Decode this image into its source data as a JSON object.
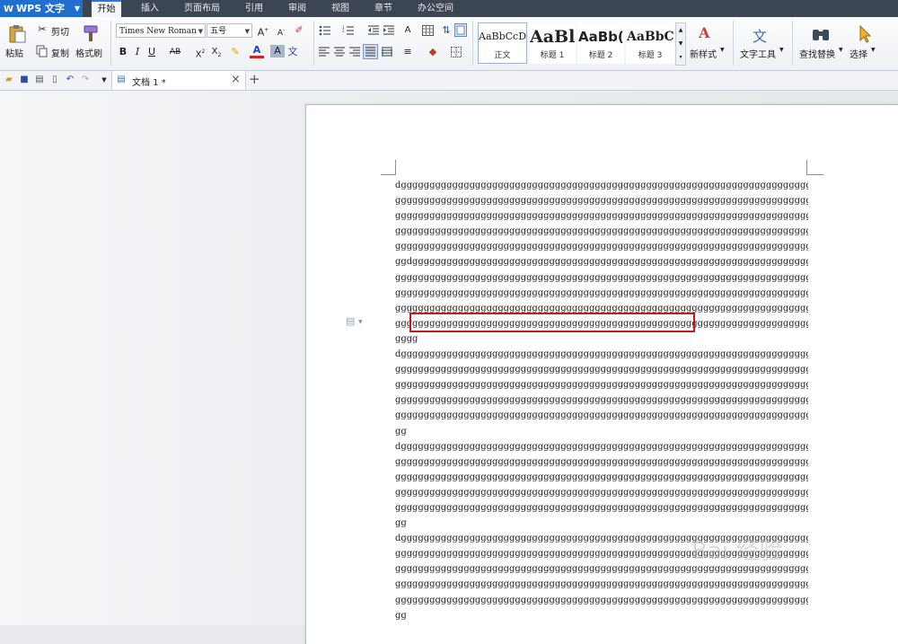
{
  "app": {
    "name": "WPS 文字"
  },
  "menu": {
    "tabs": [
      "开始",
      "插入",
      "页面布局",
      "引用",
      "审阅",
      "视图",
      "章节",
      "办公空间"
    ],
    "active": "开始"
  },
  "ribbon": {
    "clipboard": {
      "paste": "粘贴",
      "cut": "剪切",
      "copy": "复制",
      "format_painter": "格式刷"
    },
    "font": {
      "family": "Times New Roman",
      "size": "五号",
      "bold": "B",
      "italic": "I",
      "underline": "U",
      "strike": "AB"
    },
    "styles": [
      {
        "preview": "AaBbCcDd",
        "label": "正文"
      },
      {
        "preview": "AaBl",
        "label": "标题 1"
      },
      {
        "preview": "AaBb(",
        "label": "标题 2"
      },
      {
        "preview": "AaBbC",
        "label": "标题 3"
      }
    ],
    "new_style": "新样式",
    "text_tools": "文字工具",
    "find_replace": "查找替换",
    "select": "选择"
  },
  "tabbar": {
    "doc_title": "文档 1 *",
    "close": "×",
    "new_tab": "+"
  },
  "document": {
    "lines": [
      "dgggggggggggggggggggggggggggggggggggggggggggggggggggggggggggggggggggggggggg",
      "ggggggggggggggggggggggggggggggggggggggggggggggggggggggggggggggggggggggggggg",
      "ggggggggggggggggggggggggggggggggggggggggggggggggggggggggggggggggggggggggggg",
      "ggggggggggggggggggggggggggggggggggggggggggggggggggggggggggggggggggggggggggg",
      "ggggggggggggggggggggggggggggggggggggggggggggggggggggggggggggggggggggggggggg",
      "ggdgggggggggggggggggggggggggggggggggggggggggggggggggggggggggggggggggggggggg",
      "ggggggggggggggggggggggggggggggggggggggggggggggggggggggggggggggggggggggggggg",
      "ggggggggggggggggggggggggggggggggggggggggggggggggggggggggggggggggggggggggggg",
      "ggggggggggggggggggggggggggggggggggggggggggggggggggggggggggggggggggggggggggg",
      "ggggggggggggggggggggggggggggggggggggggggggggggggggggggggggggggggggggggggggg",
      "gggg",
      "dgggggggggggggggggggggggggggggggggggggggggggggggggggggggggggggggggggggggggg",
      "ggggggggggggggggggggggggggggggggggggggggggggggggggggggggggggggggggggggggggg",
      "ggggggggggggggggggggggggggggggggggggggggggggggggggggggggggggggggggggggggggg",
      "ggggggggggggggggggggggggggggggggggggggggggggggggggggggggggggggggggggggggggg",
      "ggggggggggggggggggggggggggggggggggggggggggggggggggggggggggggggggggggggggggg",
      "gg",
      "dgggggggggggggggggggggggggggggggggggggggggggggggggggggggggggggggggggggggggg",
      "ggggggggggggggggggggggggggggggggggggggggggggggggggggggggggggggggggggggggggg",
      "ggggggggggggggggggggggggggggggggggggggggggggggggggggggggggggggggggggggggggg",
      "ggggggggggggggggggggggggggggggggggggggggggggggggggggggggggggggggggggggggggg",
      "ggggggggggggggggggggggggggggggggggggggggggggggggggggggggggggggggggggggggggg",
      "gg",
      "dgggggggggggggggggggggggggggggggggggggggggggggggggggggggggggggggggggggggggg",
      "ggggggggggggggggggggggggggggggggggggggggggggggggggggggggggggggggggggggggggg",
      "ggggggggggggggggggggggggggggggggggggggggggggggggggggggggggggggggggggggggggg",
      "ggggggggggggggggggggggggggggggggggggggggggggggggggggggggggggggggggggggggggg",
      "ggggggggggggggggggggggggggggggggggggggggggggggggggggggggggggggggggggggggggg",
      "gg"
    ]
  },
  "watermark": {
    "text": "Bai 经验"
  }
}
